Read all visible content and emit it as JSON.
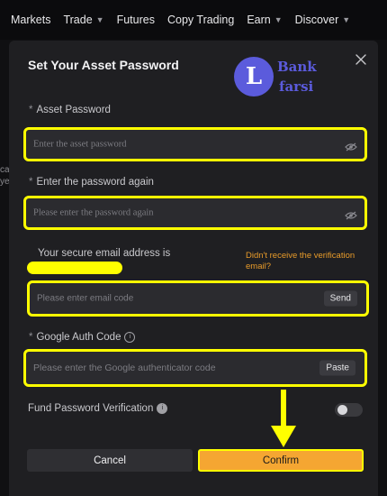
{
  "nav": {
    "items": [
      {
        "label": "Markets",
        "chevron": false
      },
      {
        "label": "Trade",
        "chevron": true
      },
      {
        "label": "Futures",
        "chevron": false
      },
      {
        "label": "Copy Trading",
        "chevron": false
      },
      {
        "label": "Earn",
        "chevron": true
      },
      {
        "label": "Discover",
        "chevron": true
      }
    ]
  },
  "background": {
    "fragment1": "ca",
    "fragment2": "ye"
  },
  "modal": {
    "title": "Set Your Asset Password",
    "close_icon": "close-icon",
    "logo": {
      "letter": "L",
      "line1": "Bank",
      "line2": "farsi"
    },
    "asset_password": {
      "label": "Asset Password",
      "placeholder": "Enter the asset password"
    },
    "confirm_password": {
      "label": "Enter the password again",
      "placeholder": "Please enter the password again"
    },
    "email": {
      "label": "Your secure email address is",
      "placeholder": "Please enter email code",
      "send_label": "Send",
      "hint": "Didn't receive the verification email?"
    },
    "google": {
      "label": "Google Auth Code",
      "placeholder": "Please enter the Google authenticator code",
      "paste_label": "Paste"
    },
    "fund_verification": {
      "label": "Fund Password Verification",
      "enabled": false
    },
    "required_mark": "*",
    "info_glyph": "i",
    "cancel_label": "Cancel",
    "confirm_label": "Confirm"
  },
  "colors": {
    "accent": "#f5a632",
    "highlight": "#ffff00",
    "modal_bg": "#1f1f22",
    "input_bg": "#2b2b2f",
    "logo": "#5b5bdc"
  }
}
